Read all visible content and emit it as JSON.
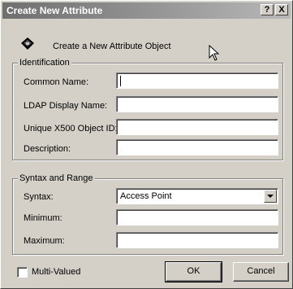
{
  "window": {
    "title": "Create New Attribute",
    "help_glyph": "?",
    "close_glyph": "X"
  },
  "header": {
    "text": "Create a New Attribute Object",
    "icon": "attribute-object-icon"
  },
  "identification": {
    "title": "Identification",
    "common_name": {
      "label": "Common Name:",
      "value": ""
    },
    "ldap_name": {
      "label": "LDAP Display Name:",
      "value": ""
    },
    "x500_oid": {
      "label": "Unique X500 Object ID:",
      "value": ""
    },
    "description": {
      "label": "Description:",
      "value": ""
    }
  },
  "syntax_range": {
    "title": "Syntax and Range",
    "syntax": {
      "label": "Syntax:",
      "selected": "Access Point"
    },
    "minimum": {
      "label": "Minimum:",
      "value": ""
    },
    "maximum": {
      "label": "Maximum:",
      "value": ""
    }
  },
  "multi_valued": {
    "label": "Multi-Valued",
    "checked": false
  },
  "buttons": {
    "ok": "OK",
    "cancel": "Cancel"
  }
}
